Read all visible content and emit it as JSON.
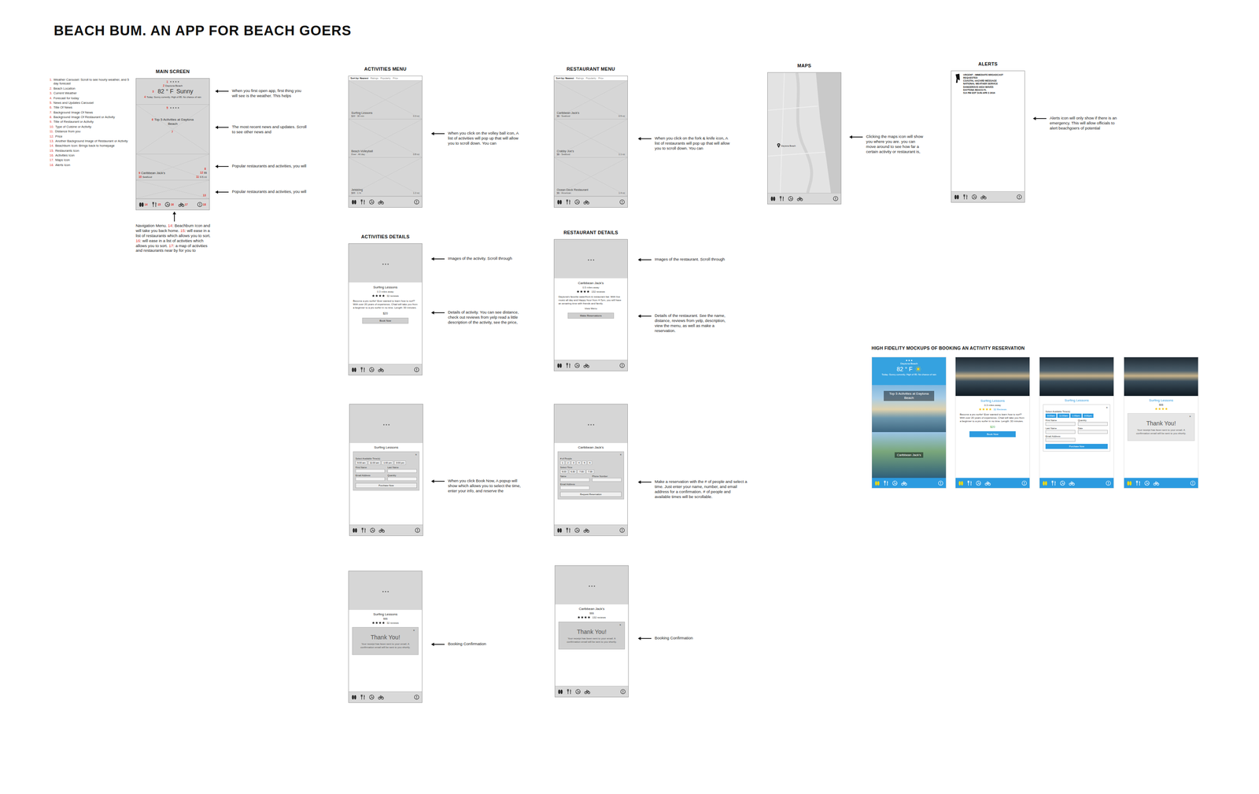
{
  "title": "BEACH BUM. AN APP FOR BEACH GOERS",
  "legend": [
    {
      "num": "1.",
      "text": "Weather Carousel: Scroll to see hourly weather, and 5 day forecast"
    },
    {
      "num": "2.",
      "text": "Beach Location"
    },
    {
      "num": "3.",
      "text": "Current Weather"
    },
    {
      "num": "4.",
      "text": "Forecast for today"
    },
    {
      "num": "5.",
      "text": "News and Updates Carousel"
    },
    {
      "num": "6.",
      "text": "Title Of News"
    },
    {
      "num": "7.",
      "text": "Background Image Of News"
    },
    {
      "num": "8.",
      "text": "Background Image Of Restaurant or Activity"
    },
    {
      "num": "9.",
      "text": "Title of Restaurant or Activity"
    },
    {
      "num": "10.",
      "text": "Type of Cuisine or Activity"
    },
    {
      "num": "11.",
      "text": "Distance from you"
    },
    {
      "num": "12.",
      "text": "Price"
    },
    {
      "num": "13.",
      "text": "Another Background Image of Restaurant or Activity"
    },
    {
      "num": "14.",
      "text": "Beachbum Icon: Brings back to homepage"
    },
    {
      "num": "15.",
      "text": "Restaurants Icon"
    },
    {
      "num": "16.",
      "text": "Activities Icon"
    },
    {
      "num": "17.",
      "text": "Maps Icon"
    },
    {
      "num": "18.",
      "text": "Alerts Icon"
    }
  ],
  "notes": [
    {
      "text": "When you first open app, first thing you will see is the weather. This helps"
    },
    {
      "text": "The most recent news and updates. Scroll to see other news and"
    },
    {
      "text": "Popular restaurants and activities, you will"
    },
    {
      "text": "Popular restaurants and activities, you will"
    },
    {
      "text": "When you click on the volley ball icon, A list of activities will pop up that will allow you to scroll down. You can"
    },
    {
      "text": "When you click on the fork & knife icon, A list of restaurants will pop up that will allow you to scroll down. You can"
    },
    {
      "text": "Clicking the maps icon will show you where you are. you can move around to see how far a certain activity or restaurant is,"
    },
    {
      "text": "Alerts icon will only show if there is an emergency. This will allow officials to alert beachgoers of potential"
    },
    {
      "text": "Images of the activity. Scroll through"
    },
    {
      "text": "Details of activity. You can see distance, check out reviews from yelp read a little description of the activity, see the price,"
    },
    {
      "text": "Images of the restaurant. Scroll through"
    },
    {
      "text": "Details of the restaurant. See the name, distance, reviews from yelp, description, view the menu, as well as make a reservation."
    },
    {
      "text": "When you click Book Now, A popup will show which allows you to select the time, enter your info, and reserve the"
    },
    {
      "text": "Make a reservation with the # of people and select a time. Just enter your name, number, and email address for a confirmation. # of people and available times will be scrollable."
    },
    {
      "text": "Booking Confirmation"
    },
    {
      "text": "Booking Confirmation"
    }
  ],
  "nav_note": {
    "parts": [
      {
        "text": "Navigation Menu. ",
        "marker": false
      },
      {
        "text": "14",
        "marker": true
      },
      {
        "text": ": Beachbum Icon and will take you back home. ",
        "marker": false
      },
      {
        "text": "15",
        "marker": true
      },
      {
        "text": ": will ease in a list of restaurants which allows you to sort. ",
        "marker": false
      },
      {
        "text": "16",
        "marker": true
      },
      {
        "text": ": will ease in a list of activities which allows you to sort. ",
        "marker": false
      },
      {
        "text": "17",
        "marker": true
      },
      {
        "text": ": a map of activities and restaurants near by for you to",
        "marker": false
      }
    ]
  },
  "screens": [
    {
      "kind": "home",
      "label": "MAIN SCREEN",
      "weather_marker": "1",
      "pager_dots": 4,
      "location": "Daytona Beach",
      "location_marker": "2",
      "temperature": "82 ° F",
      "condition": "Sunny",
      "temperature_marker": "3",
      "forecast": "Today: Sunny currently. High of 85. No chance of rain",
      "forecast_marker": "4",
      "news_marker": "5",
      "news_dots": 4,
      "news_title": "Top 5 Activities at Daytona Beach",
      "news_title_marker": "6",
      "news_image_marker": "7",
      "places": [
        {
          "image_marker": "8",
          "title": "Caribbean Jack's",
          "title_marker": "9",
          "type": "Seafood",
          "type_marker": "10",
          "distance": "0.5 mi",
          "distance_marker": "11",
          "price": "$$",
          "price_marker": "12"
        },
        {
          "image_marker": "13"
        }
      ],
      "nav_markers": [
        "14",
        "15",
        "16",
        "17",
        "18"
      ]
    },
    {
      "kind": "list",
      "label": "ACTIVITIES MENU",
      "sort": [
        {
          "label": "Sort by: Nearest",
          "selected": true
        },
        {
          "label": "Ratings",
          "selected": false
        },
        {
          "label": "Popularity",
          "selected": false
        },
        {
          "label": "Price",
          "selected": false
        }
      ],
      "items": [
        {
          "title": "Surfing Lessons",
          "meta": "$20 · 30 min",
          "distance": "0.3 mi"
        },
        {
          "title": "Beach Volleyball",
          "meta": "Free · All day",
          "distance": "0.8 mi"
        },
        {
          "title": "Jetskiing",
          "meta": "$65 · 1 hr",
          "distance": "1.2 mi"
        }
      ]
    },
    {
      "kind": "list",
      "label": "RESTAURANT MENU",
      "sort": [
        {
          "label": "Sort by: Nearest",
          "selected": true
        },
        {
          "label": "Ratings",
          "selected": false
        },
        {
          "label": "Popularity",
          "selected": false
        },
        {
          "label": "Price",
          "selected": false
        }
      ],
      "items": [
        {
          "title": "Caribbean Jack's",
          "meta": "$$ · Seafood",
          "distance": "0.5 mi"
        },
        {
          "title": "Crabby Joe's",
          "meta": "$$ · Seafood",
          "distance": "1.1 mi"
        },
        {
          "title": "Ocean Deck Restaurant",
          "meta": "$$ · American",
          "distance": "1.4 mi"
        }
      ]
    },
    {
      "kind": "map",
      "label": "MAPS",
      "pin_label": "Daytona Beach"
    },
    {
      "kind": "alerts",
      "label": "ALERTS",
      "lines": [
        "URGENT - IMMEDIATE BROADCAST",
        "REQUESTED",
        "COASTAL HAZARD MESSAGE",
        "NATIONAL WEATHER SERVICE",
        "DANGEROUS HIGH WAVES",
        "DAYTONA BEACH FL",
        "514 PM EDT SUN APR 3 2016"
      ]
    },
    {
      "kind": "details",
      "label": "ACTIVITIES DETAILS",
      "image_dots": 3,
      "title": "Surfing Lessons",
      "distance": "0.3 miles away",
      "stars": 4,
      "reviews": "32 reviews",
      "description": "Become a pro surfer! Ever wanted to learn how to surf? With over 20 years of experience, Chad will take you from a beginner to a pro surfer in no time. Length: 30 minutes.",
      "price": "$20",
      "button": "Book Now"
    },
    {
      "kind": "details",
      "label": "RESTAURANT DETAILS",
      "image_dots": 3,
      "title": "Caribbean Jack's",
      "distance": "0.5 miles away",
      "stars": 4,
      "reviews": "132 reviews",
      "description": "Daytona's favorite waterfront & restaurant bar. With live music all day and Happy hour from 4-7pm, you will have an amazing time with friends and family.",
      "link": "View Menu",
      "button": "Make Reservations"
    },
    {
      "kind": "booking",
      "image_dots": 3,
      "title": "Surfing Lessons",
      "popup": {
        "close": "×",
        "groups": [
          {
            "heading": "Select Available Time(s)",
            "options": [
              "9:00 am",
              "11:00 am",
              "1:00 pm",
              "3:00 pm"
            ]
          }
        ],
        "fields": [
          "First Name",
          "Last Name",
          "Email Address",
          "Quantity"
        ],
        "button": "Purchase Now"
      }
    },
    {
      "kind": "booking",
      "image_dots": 3,
      "title": "Caribbean Jack's",
      "popup": {
        "close": "×",
        "groups": [
          {
            "heading": "# of People",
            "options": [
              "1",
              "2",
              "3",
              "4",
              "5",
              "6"
            ]
          },
          {
            "heading": "Select Time",
            "options": [
              "6:00",
              "6:30",
              "7:00",
              "7:30"
            ]
          }
        ],
        "fields": [
          "Name",
          "Phone Number",
          "Email Address"
        ],
        "button": "Request Reservation"
      }
    },
    {
      "kind": "confirm",
      "image_dots": 3,
      "title": "Surfing Lessons",
      "price": "$$$",
      "stars": 4,
      "reviews": "32 reviews",
      "popup": {
        "close": "×",
        "heading": "Thank You!",
        "message": "Your receipt has been sent to your email. A confirmation email will be sent to you shortly."
      }
    },
    {
      "kind": "confirm",
      "image_dots": 3,
      "title": "Caribbean Jack's",
      "price": "$$$",
      "stars": 4,
      "reviews": "132 reviews",
      "popup": {
        "close": "×",
        "heading": "Thank You!",
        "message": "Your receipt has been sent to your email. A confirmation email will be sent to you shortly."
      }
    }
  ],
  "hifi": {
    "label": "HIGH FIDELITY MOCKUPS OF BOOKING AN ACTIVITY RESERVATION",
    "screens": [
      {
        "kind": "home",
        "pager_dots": 3,
        "location": "Daytona Beach",
        "temperature": "82 ° F",
        "forecast": "Today: Sunny currently. High of 85. No chance of rain",
        "news_title": "Top 5 Activities at Daytona Beach",
        "places": [
          {
            "title": "Caribbean Jack's"
          }
        ]
      },
      {
        "kind": "details",
        "title": "Surfing Lessons",
        "distance": "0.3 miles away",
        "stars": 4,
        "reviews": "32 Reviews",
        "description": "Become a pro surfer! Ever wanted to learn how to surf? With over 20 years of experience, Chad will take you from a beginner to a pro surfer in no time. Length: 30 minutes.",
        "price": "$20",
        "button": "Book Now"
      },
      {
        "kind": "booking",
        "title": "Surfing Lessons",
        "popup": {
          "close": "×",
          "groups": [
            {
              "heading": "Select Available Time(s)",
              "options": [
                "9:00am",
                "11:00am",
                "1:00pm",
                "3:00pm"
              ]
            }
          ],
          "fields": [
            "First Name",
            "Quantity",
            "Last Name",
            "Date",
            "Email Address"
          ],
          "button": "Purchase Now"
        }
      },
      {
        "kind": "confirm",
        "title": "Surfing Lessons",
        "price": "$$$",
        "stars": 4,
        "popup": {
          "close": "×",
          "heading": "Thank You!",
          "message": "Your receipt has been sent to your email. A confirmation email will be sent to you shortly."
        }
      }
    ]
  }
}
